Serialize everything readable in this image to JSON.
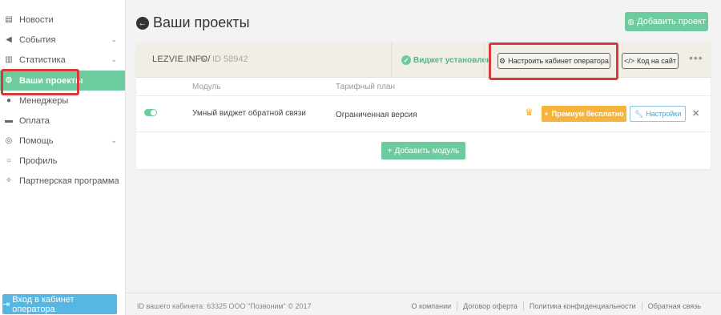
{
  "sidebar": {
    "items": [
      {
        "label": "Новости",
        "icon": "news-icon",
        "glyph": "▤",
        "chevron": false
      },
      {
        "label": "События",
        "icon": "megaphone-icon",
        "glyph": "◀",
        "chevron": true
      },
      {
        "label": "Статистика",
        "icon": "bar-chart-icon",
        "glyph": "▥",
        "chevron": true
      },
      {
        "label": "Ваши проекты",
        "icon": "gears-icon",
        "glyph": "⚙",
        "chevron": false,
        "active": true
      },
      {
        "label": "Менеджеры",
        "icon": "users-icon",
        "glyph": "●",
        "chevron": false
      },
      {
        "label": "Оплата",
        "icon": "credit-card-icon",
        "glyph": "▬",
        "chevron": false
      },
      {
        "label": "Помощь",
        "icon": "lifebuoy-icon",
        "glyph": "◎",
        "chevron": true
      },
      {
        "label": "Профиль",
        "icon": "user-icon",
        "glyph": "○",
        "chevron": false
      },
      {
        "label": "Партнерская программа",
        "icon": "handshake-icon",
        "glyph": "✧",
        "chevron": false
      }
    ],
    "operator_button": "Вход в кабинет оператора"
  },
  "header": {
    "title": "Ваши проекты",
    "add_project": "Добавить проект"
  },
  "project": {
    "site": "LEZVIE.INFO/",
    "id_text": "ID 58942",
    "widget_status": "Виджет установлен",
    "configure_cabinet": "Настроить кабинет оператора",
    "code_button": "Код на сайт",
    "columns": {
      "module": "Модуль",
      "plan": "Тарифный план"
    },
    "module": {
      "name": "Умный виджет обратной связи",
      "plan": "Ограниченная версия",
      "enabled": true,
      "premium_button": "Премиум бесплатно",
      "settings_button": "Настройки"
    },
    "add_module": "Добавить модуль"
  },
  "footer": {
    "text": "ID вашего кабинета: 63325 ООО \"Позвоним\" © 2017",
    "links": [
      "О компании",
      "Договор оферта",
      "Политика конфиденциальности",
      "Обратная связь"
    ]
  },
  "colors": {
    "accent_green": "#6ccc9e",
    "accent_blue": "#56b7e3",
    "premium_orange": "#f6b43c",
    "highlight_red": "#d63a3a"
  }
}
